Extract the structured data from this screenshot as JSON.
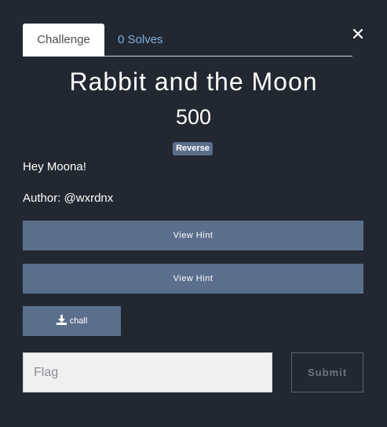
{
  "close": {
    "icon": "close-icon"
  },
  "tabs": [
    {
      "label": "Challenge",
      "active": true
    },
    {
      "label": "0 Solves",
      "active": false
    }
  ],
  "challenge": {
    "title": "Rabbit and the Moon",
    "value": "500",
    "tag": "Reverse",
    "description": [
      "Hey Moona!",
      "Author: @wxrdnx"
    ]
  },
  "hints": [
    "View Hint",
    "View Hint"
  ],
  "file": {
    "label": "chall",
    "icon": "download-icon"
  },
  "flag_input": {
    "placeholder": "Flag",
    "value": ""
  },
  "submit": {
    "label": "Submit"
  },
  "colors": {
    "background": "#222831",
    "button": "#5b6e8c",
    "tab_link": "#7fb0dd"
  }
}
